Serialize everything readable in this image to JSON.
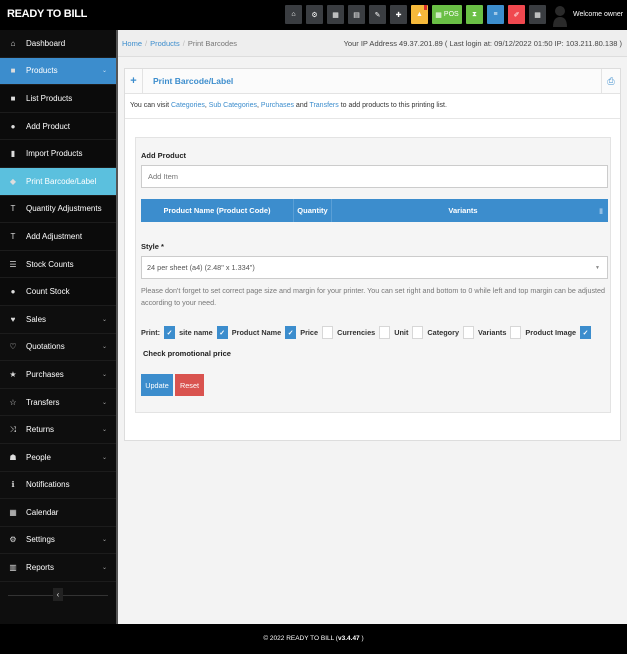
{
  "app": {
    "brand": "READY TO BILL",
    "welcome": "Welcome owner"
  },
  "topbar": {
    "buttons": [
      {
        "icon": "home-icon",
        "glyph": "⌂",
        "color": "#3a3d41"
      },
      {
        "icon": "cogs-icon",
        "glyph": "⚙",
        "color": "#3a3d41"
      },
      {
        "icon": "calculator-icon",
        "glyph": "▦",
        "color": "#3a3d41"
      },
      {
        "icon": "calendar-icon",
        "glyph": "▤",
        "color": "#3a3d41"
      },
      {
        "icon": "sticky-note-icon",
        "glyph": "✎",
        "color": "#3a3d41"
      },
      {
        "icon": "language-flag-icon",
        "glyph": "✚",
        "color": "#3a3d41"
      },
      {
        "icon": "alert-warning-icon",
        "glyph": "▲",
        "color": "#f6b93b"
      },
      {
        "icon": "pos-icon",
        "glyph": "▦",
        "label": "POS",
        "color": "#6abf45"
      },
      {
        "icon": "hourglass-icon",
        "glyph": "⧗",
        "color": "#6abf45"
      },
      {
        "icon": "list-icon",
        "glyph": "≡",
        "color": "#3c8dcd"
      },
      {
        "icon": "eraser-icon",
        "glyph": "✐",
        "color": "#f0484f"
      },
      {
        "icon": "dashboard-grid-icon",
        "glyph": "▦",
        "color": "#3a3d41"
      }
    ]
  },
  "sidebar": {
    "items": [
      {
        "label": "Dashboard",
        "icon": "dashboard-icon",
        "glyph": "⌂",
        "chevron": false,
        "state": ""
      },
      {
        "label": "Products",
        "icon": "barcode-icon",
        "glyph": "■",
        "chevron": true,
        "state": "active"
      },
      {
        "label": "List Products",
        "icon": "barcode-icon",
        "glyph": "■",
        "chevron": false,
        "state": "sub"
      },
      {
        "label": "Add Product",
        "icon": "plus-circle-icon",
        "glyph": "●",
        "chevron": false,
        "state": "sub"
      },
      {
        "label": "Import Products",
        "icon": "file-icon",
        "glyph": "▮",
        "chevron": false,
        "state": "sub"
      },
      {
        "label": "Print Barcode/Label",
        "icon": "tags-icon",
        "glyph": "◆",
        "chevron": false,
        "state": "current"
      },
      {
        "label": "Quantity Adjustments",
        "icon": "filter-icon",
        "glyph": "T",
        "chevron": false,
        "state": "sub"
      },
      {
        "label": "Add Adjustment",
        "icon": "filter-icon",
        "glyph": "T",
        "chevron": false,
        "state": "sub"
      },
      {
        "label": "Stock Counts",
        "icon": "list-ol-icon",
        "glyph": "☰",
        "chevron": false,
        "state": "sub"
      },
      {
        "label": "Count Stock",
        "icon": "plus-circle-icon",
        "glyph": "●",
        "chevron": false,
        "state": "sub"
      },
      {
        "label": "Sales",
        "icon": "heart-icon",
        "glyph": "♥",
        "chevron": true,
        "state": ""
      },
      {
        "label": "Quotations",
        "icon": "heart-outline-icon",
        "glyph": "♡",
        "chevron": true,
        "state": ""
      },
      {
        "label": "Purchases",
        "icon": "star-icon",
        "glyph": "★",
        "chevron": true,
        "state": ""
      },
      {
        "label": "Transfers",
        "icon": "star-outline-icon",
        "glyph": "☆",
        "chevron": true,
        "state": ""
      },
      {
        "label": "Returns",
        "icon": "random-icon",
        "glyph": "⤨",
        "chevron": true,
        "state": ""
      },
      {
        "label": "People",
        "icon": "users-icon",
        "glyph": "☗",
        "chevron": true,
        "state": ""
      },
      {
        "label": "Notifications",
        "icon": "info-circle-icon",
        "glyph": "ℹ",
        "chevron": false,
        "state": ""
      },
      {
        "label": "Calendar",
        "icon": "calendar-icon",
        "glyph": "▦",
        "chevron": false,
        "state": ""
      },
      {
        "label": "Settings",
        "icon": "cog-icon",
        "glyph": "⚙",
        "chevron": true,
        "state": ""
      },
      {
        "label": "Reports",
        "icon": "bar-chart-icon",
        "glyph": "▥",
        "chevron": true,
        "state": ""
      }
    ],
    "collapse_glyph": "‹"
  },
  "breadcrumb": {
    "home": "Home",
    "products": "Products",
    "current": "Print Barcodes"
  },
  "ip_info": "Your IP Address 49.37.201.89 ( Last login at: 09/12/2022 01:50 IP: 103.211.80.138 )",
  "box": {
    "title": "Print Barcode/Label",
    "intro_prefix": "You can visit ",
    "link_categories": "Categories",
    "sep1": ", ",
    "link_subcategories": "Sub Categories",
    "sep2": ", ",
    "link_purchases": "Purchases",
    "and": " and ",
    "link_transfers": "Transfers",
    "intro_suffix": " to add products to this printing list."
  },
  "form": {
    "add_product_label": "Add Product",
    "add_item_placeholder": "Add Item",
    "table_headers": [
      "Product Name (Product Code)",
      "Quantity",
      "Variants"
    ],
    "trash_glyph": "🗑",
    "style_label": "Style *",
    "style_value": "24 per sheet (a4) (2.48\" x 1.334\")",
    "help_text": "Please don't forget to set correct page size and margin for your printer. You can set right and bottom to 0 while left and top margin can be adjusted according to your need.",
    "print_label": "Print:",
    "print_options": [
      {
        "label": "site name",
        "checked": true
      },
      {
        "label": "Product Name",
        "checked": true
      },
      {
        "label": "Price",
        "checked": true
      },
      {
        "label": "Currencies",
        "checked": false
      },
      {
        "label": "Unit",
        "checked": false
      },
      {
        "label": "Category",
        "checked": false
      },
      {
        "label": "Variants",
        "checked": false
      },
      {
        "label": "Product Image",
        "checked": false
      },
      {
        "label": "Check promotional price",
        "checked": true
      }
    ],
    "update_label": "Update",
    "reset_label": "Reset"
  },
  "footer": {
    "text": "© 2022 READY TO BILL (",
    "version": "v3.4.47",
    "close": " )"
  }
}
